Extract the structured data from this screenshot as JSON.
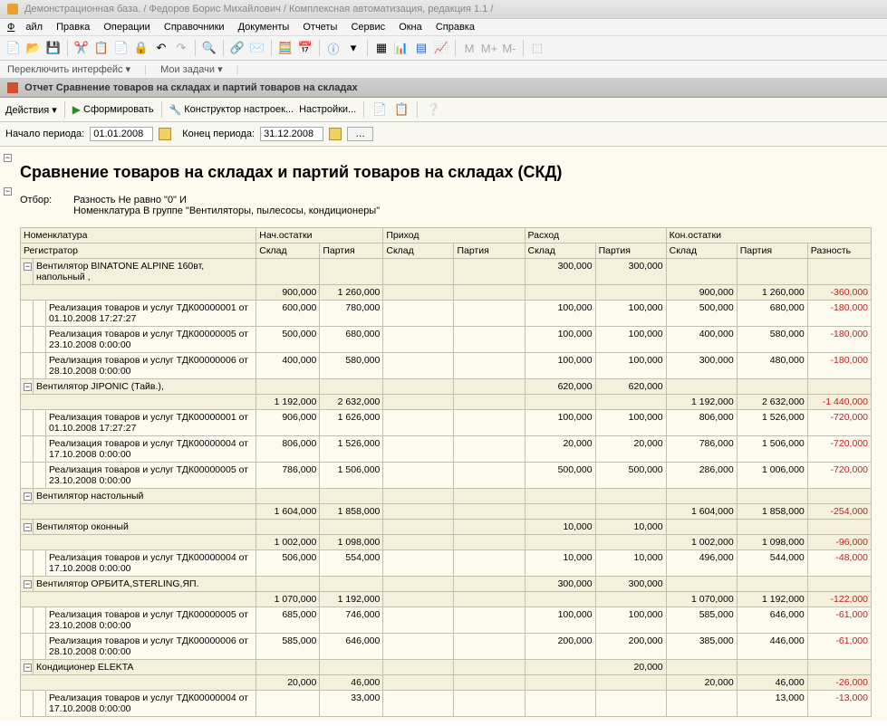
{
  "title": "Демонстрационная база. / Федоров Борис Михайлович / Комплексная автоматизация, редакция 1.1 /",
  "menu": {
    "file": "Файл",
    "edit": "Правка",
    "ops": "Операции",
    "refs": "Справочники",
    "docs": "Документы",
    "reports": "Отчеты",
    "service": "Сервис",
    "windows": "Окна",
    "help": "Справка"
  },
  "iface": {
    "switch": "Переключить интерфейс ▾",
    "tasks": "Мои задачи ▾"
  },
  "docTitle": "Отчет  Сравнение товаров на складах и партий товаров на складах",
  "actions": {
    "actions": "Действия ▾",
    "form": "Сформировать",
    "constructor": "Конструктор настроек...",
    "settings": "Настройки..."
  },
  "period": {
    "startLabel": "Начало периода:",
    "start": "01.01.2008",
    "endLabel": "Конец периода:",
    "end": "31.12.2008"
  },
  "report": {
    "title": "Сравнение товаров на складах и партий товаров на складах (СКД)",
    "filterLabel": "Отбор:",
    "filterLine1": "Разность Не равно \"0\" И",
    "filterLine2": "Номенклатура В группе \"Вентиляторы, пылесосы, кондиционеры\""
  },
  "headers": {
    "nomen": "Номенклатура",
    "reg": "Регистратор",
    "begin": "Нач.остатки",
    "income": "Приход",
    "expense": "Расход",
    "end": "Кон.остатки",
    "sklad": "Склад",
    "party": "Партия",
    "diff": "Разность"
  },
  "rows": [
    {
      "type": "group",
      "indent": 0,
      "name": "Вентилятор BINATONE ALPINE 160вт, напольный ,",
      "c": [
        "",
        "",
        "",
        "",
        "300,000",
        "300,000",
        "",
        "",
        ""
      ]
    },
    {
      "type": "sum",
      "c": [
        "900,000",
        "1 260,000",
        "",
        "",
        "",
        "",
        "900,000",
        "1 260,000",
        "-360,000"
      ]
    },
    {
      "type": "detail",
      "name": "Реализация товаров и услуг ТДК00000001 от 01.10.2008 17:27:27",
      "c": [
        "600,000",
        "780,000",
        "",
        "",
        "100,000",
        "100,000",
        "500,000",
        "680,000",
        "-180,000"
      ]
    },
    {
      "type": "detail",
      "name": "Реализация товаров и услуг ТДК00000005 от 23.10.2008 0:00:00",
      "c": [
        "500,000",
        "680,000",
        "",
        "",
        "100,000",
        "100,000",
        "400,000",
        "580,000",
        "-180,000"
      ]
    },
    {
      "type": "detail",
      "name": "Реализация товаров и услуг ТДК00000006 от 28.10.2008 0:00:00",
      "c": [
        "400,000",
        "580,000",
        "",
        "",
        "100,000",
        "100,000",
        "300,000",
        "480,000",
        "-180,000"
      ]
    },
    {
      "type": "group",
      "indent": 0,
      "name": "Вентилятор JIPONIC (Тайв.),",
      "c": [
        "",
        "",
        "",
        "",
        "620,000",
        "620,000",
        "",
        "",
        ""
      ]
    },
    {
      "type": "sum",
      "c": [
        "1 192,000",
        "2 632,000",
        "",
        "",
        "",
        "",
        "1 192,000",
        "2 632,000",
        "-1 440,000"
      ]
    },
    {
      "type": "detail",
      "name": "Реализация товаров и услуг ТДК00000001 от 01.10.2008 17:27:27",
      "c": [
        "906,000",
        "1 626,000",
        "",
        "",
        "100,000",
        "100,000",
        "806,000",
        "1 526,000",
        "-720,000"
      ]
    },
    {
      "type": "detail",
      "name": "Реализация товаров и услуг ТДК00000004 от 17.10.2008 0:00:00",
      "c": [
        "806,000",
        "1 526,000",
        "",
        "",
        "20,000",
        "20,000",
        "786,000",
        "1 506,000",
        "-720,000"
      ]
    },
    {
      "type": "detail",
      "name": "Реализация товаров и услуг ТДК00000005 от 23.10.2008 0:00:00",
      "c": [
        "786,000",
        "1 506,000",
        "",
        "",
        "500,000",
        "500,000",
        "286,000",
        "1 006,000",
        "-720,000"
      ]
    },
    {
      "type": "group",
      "indent": 0,
      "name": "Вентилятор настольный",
      "c": [
        "",
        "",
        "",
        "",
        "",
        "",
        "",
        "",
        ""
      ]
    },
    {
      "type": "sum",
      "c": [
        "1 604,000",
        "1 858,000",
        "",
        "",
        "",
        "",
        "1 604,000",
        "1 858,000",
        "-254,000"
      ]
    },
    {
      "type": "group",
      "indent": 0,
      "name": "Вентилятор оконный",
      "c": [
        "",
        "",
        "",
        "",
        "10,000",
        "10,000",
        "",
        "",
        ""
      ]
    },
    {
      "type": "sum",
      "c": [
        "1 002,000",
        "1 098,000",
        "",
        "",
        "",
        "",
        "1 002,000",
        "1 098,000",
        "-96,000"
      ]
    },
    {
      "type": "detail",
      "name": "Реализация товаров и услуг ТДК00000004 от 17.10.2008 0:00:00",
      "c": [
        "506,000",
        "554,000",
        "",
        "",
        "10,000",
        "10,000",
        "496,000",
        "544,000",
        "-48,000"
      ]
    },
    {
      "type": "group",
      "indent": 0,
      "name": "Вентилятор ОРБИТА,STERLING,ЯП.",
      "c": [
        "",
        "",
        "",
        "",
        "300,000",
        "300,000",
        "",
        "",
        ""
      ]
    },
    {
      "type": "sum",
      "c": [
        "1 070,000",
        "1 192,000",
        "",
        "",
        "",
        "",
        "1 070,000",
        "1 192,000",
        "-122,000"
      ]
    },
    {
      "type": "detail",
      "name": "Реализация товаров и услуг ТДК00000005 от 23.10.2008 0:00:00",
      "c": [
        "685,000",
        "746,000",
        "",
        "",
        "100,000",
        "100,000",
        "585,000",
        "646,000",
        "-61,000"
      ]
    },
    {
      "type": "detail",
      "name": "Реализация товаров и услуг ТДК00000006 от 28.10.2008 0:00:00",
      "c": [
        "585,000",
        "646,000",
        "",
        "",
        "200,000",
        "200,000",
        "385,000",
        "446,000",
        "-61,000"
      ]
    },
    {
      "type": "group",
      "indent": 0,
      "name": "Кондиционер ELEKTA",
      "c": [
        "",
        "",
        "",
        "",
        "",
        "20,000",
        "",
        "",
        ""
      ]
    },
    {
      "type": "sum",
      "c": [
        "20,000",
        "46,000",
        "",
        "",
        "",
        "",
        "20,000",
        "46,000",
        "-26,000"
      ]
    },
    {
      "type": "detail",
      "name": "Реализация товаров и услуг ТДК00000004 от 17.10.2008 0:00:00",
      "c": [
        "",
        "33,000",
        "",
        "",
        "",
        "",
        "",
        "13,000",
        "-13,000"
      ]
    }
  ],
  "mtext": {
    "m": "M",
    "mp": "M+",
    "mm": "M-"
  }
}
